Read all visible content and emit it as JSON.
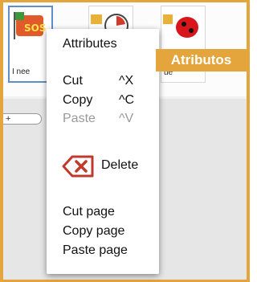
{
  "tiles": [
    {
      "label": "I nee"
    },
    {
      "label": ""
    },
    {
      "label": "ue"
    }
  ],
  "pane": {
    "field_text": "+"
  },
  "menu": {
    "attributes": "Attributes",
    "cut": "Cut",
    "cut_shortcut": "^X",
    "copy": "Copy",
    "copy_shortcut": "^C",
    "paste": "Paste",
    "paste_shortcut": "^V",
    "delete": "Delete",
    "cut_page": "Cut page",
    "copy_page": "Copy page",
    "paste_page": "Paste page"
  },
  "badge": {
    "text": "Atributos"
  },
  "colors": {
    "accent": "#e3a53c",
    "delete_red": "#c0392b",
    "selection": "#5f8ec9"
  },
  "icons": [
    "sos-flag-icon",
    "clock-icon",
    "ladybug-icon",
    "delete-icon"
  ]
}
